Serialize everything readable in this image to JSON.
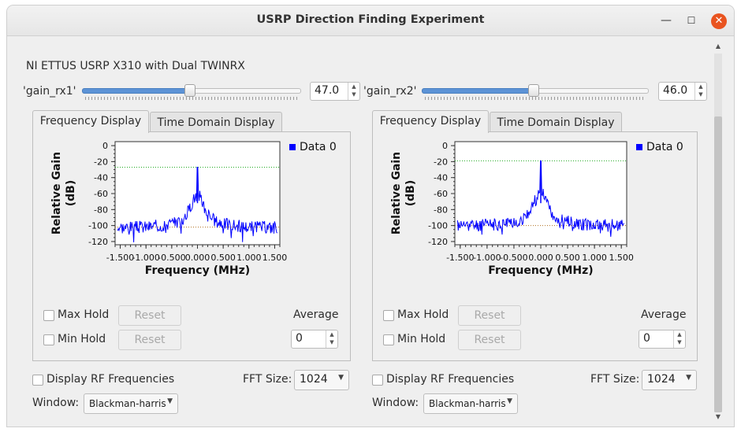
{
  "window": {
    "title": "USRP Direction Finding Experiment"
  },
  "header": {
    "device_label": "NI ETTUS USRP X310 with Dual TWINRX"
  },
  "gains": [
    {
      "label": "'gain_rx1'",
      "value": "47.0",
      "fraction": 0.49
    },
    {
      "label": "'gain_rx2'",
      "value": "46.0",
      "fraction": 0.49
    }
  ],
  "panels": [
    {
      "tabs": [
        "Frequency Display",
        "Time Domain Display"
      ],
      "chart_data": {
        "type": "line",
        "xlabel": "Frequency (MHz)",
        "ylabel_line1": "Relative Gain",
        "ylabel_line2": "(dB)",
        "xlim": [
          -1.6,
          1.6
        ],
        "ylim": [
          -124,
          5
        ],
        "x_ticks": [
          "-1.500",
          "-1.000",
          "-0.500",
          "0.000",
          "0.500",
          "1.000",
          "1.500"
        ],
        "y_ticks": [
          "0",
          "-20",
          "-40",
          "-60",
          "-80",
          "-100",
          "-120"
        ],
        "legend": "Data 0",
        "series_color": "#0000ff",
        "noise_floor_db": -102,
        "peak_db": -27,
        "threshold_line_db": -27,
        "series": [
          {
            "name": "Data 0",
            "seed": 3
          }
        ]
      },
      "max_hold": "Max Hold",
      "min_hold": "Min Hold",
      "reset": "Reset",
      "average_label": "Average",
      "average_value": "0",
      "display_rf": "Display RF Frequencies",
      "fft_label": "FFT Size:",
      "fft_value": "1024",
      "window_label": "Window:",
      "window_value": "Blackman-harris"
    },
    {
      "tabs": [
        "Frequency Display",
        "Time Domain Display"
      ],
      "chart_data": {
        "type": "line",
        "xlabel": "Frequency (MHz)",
        "ylabel_line1": "Relative Gain",
        "ylabel_line2": "(dB)",
        "xlim": [
          -1.6,
          1.6
        ],
        "ylim": [
          -124,
          5
        ],
        "x_ticks": [
          "-1.500",
          "-1.000",
          "-0.500",
          "0.000",
          "0.500",
          "1.000",
          "1.500"
        ],
        "y_ticks": [
          "0",
          "-20",
          "-40",
          "-60",
          "-80",
          "-100",
          "-120"
        ],
        "legend": "Data 0",
        "series_color": "#0000ff",
        "noise_floor_db": -100,
        "peak_db": -19,
        "threshold_line_db": -19,
        "series": [
          {
            "name": "Data 0",
            "seed": 11
          }
        ]
      },
      "max_hold": "Max Hold",
      "min_hold": "Min Hold",
      "reset": "Reset",
      "average_label": "Average",
      "average_value": "0",
      "display_rf": "Display RF Frequencies",
      "fft_label": "FFT Size:",
      "fft_value": "1024",
      "window_label": "Window:",
      "window_value": "Blackman-harris"
    }
  ]
}
